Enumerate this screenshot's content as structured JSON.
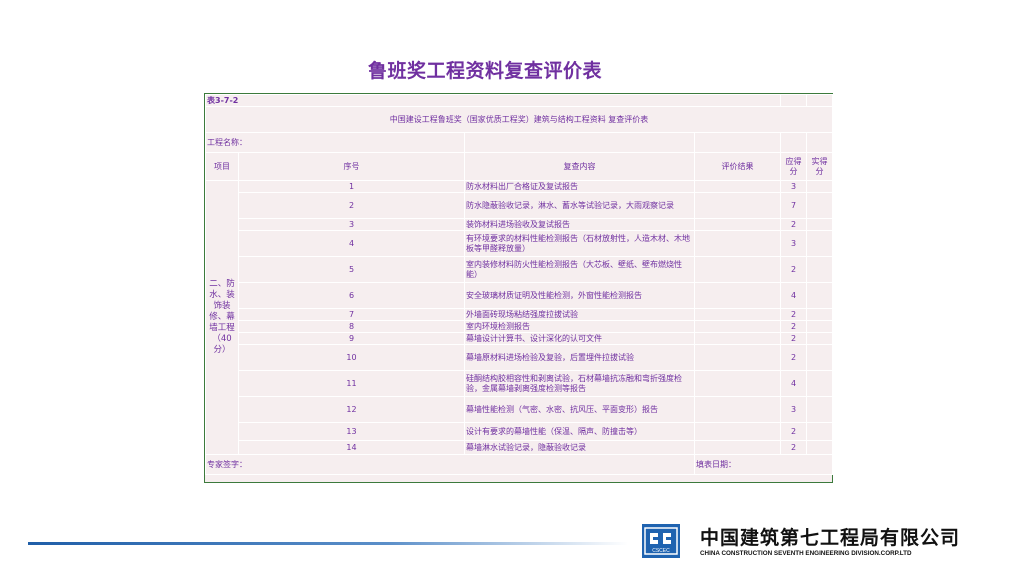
{
  "title": "鲁班奖工程资料复查评价表",
  "table": {
    "code": "表3-7-2",
    "subtitle": "中国建设工程鲁班奖（国家优质工程奖）建筑与结构工程资料 复查评价表",
    "project_name_label": "工程名称：",
    "headers": {
      "item": "项目",
      "seq": "序号",
      "content": "复查内容",
      "result": "评价结果",
      "due": "应得分",
      "actual": "实得分"
    },
    "section_label": "二、防水、装饰装修、幕墙工程（40分）",
    "rows": [
      {
        "seq": "1",
        "content": "防水材料出厂合格证及复试报告",
        "due": "3"
      },
      {
        "seq": "2",
        "content": "防水隐蔽验收记录，淋水、蓄水等试验记录，大雨观察记录",
        "due": "7"
      },
      {
        "seq": "3",
        "content": "装饰材料进场验收及复试报告",
        "due": "2"
      },
      {
        "seq": "4",
        "content": "有环境要求的材料性能检测报告（石材放射性，人造木材、木地板等甲醛释放量）",
        "due": "3"
      },
      {
        "seq": "5",
        "content": "室内装修材料防火性能检测报告（大芯板、壁纸、壁布燃烧性能）",
        "due": "2"
      },
      {
        "seq": "6",
        "content": "安全玻璃材质证明及性能检测，外窗性能检测报告",
        "due": "4"
      },
      {
        "seq": "7",
        "content": "外墙面砖现场粘结强度拉拔试验",
        "due": "2"
      },
      {
        "seq": "8",
        "content": "室内环境检测报告",
        "due": "2"
      },
      {
        "seq": "9",
        "content": "幕墙设计计算书、设计深化的认可文件",
        "due": "2"
      },
      {
        "seq": "10",
        "content": "幕墙原材料进场检验及复验，后置埋件拉拔试验",
        "due": "2"
      },
      {
        "seq": "11",
        "content": "硅酮结构胶相容性和剥离试验，石材幕墙抗冻融和弯折强度检验，金属幕墙剥离强度检测等报告",
        "due": "4"
      },
      {
        "seq": "12",
        "content": "幕墙性能检测（气密、水密、抗风压、平面变形）报告",
        "due": "3"
      },
      {
        "seq": "13",
        "content": "设计有要求的幕墙性能（保温、隔声、防撞击等）",
        "due": "2"
      },
      {
        "seq": "14",
        "content": "幕墙淋水试验记录，隐蔽验收记录",
        "due": "2"
      }
    ],
    "expert_sign_label": "专家签字：",
    "fill_date_label": "填表日期："
  },
  "footer": {
    "company_cn": "中国建筑第七工程局有限公司",
    "company_en": "CHINA CONSTRUCTION SEVENTH ENGINEERING DIVISION.CORP.LTD",
    "logo_text": "CSCEC",
    "brand_color": "#1f63b0"
  }
}
